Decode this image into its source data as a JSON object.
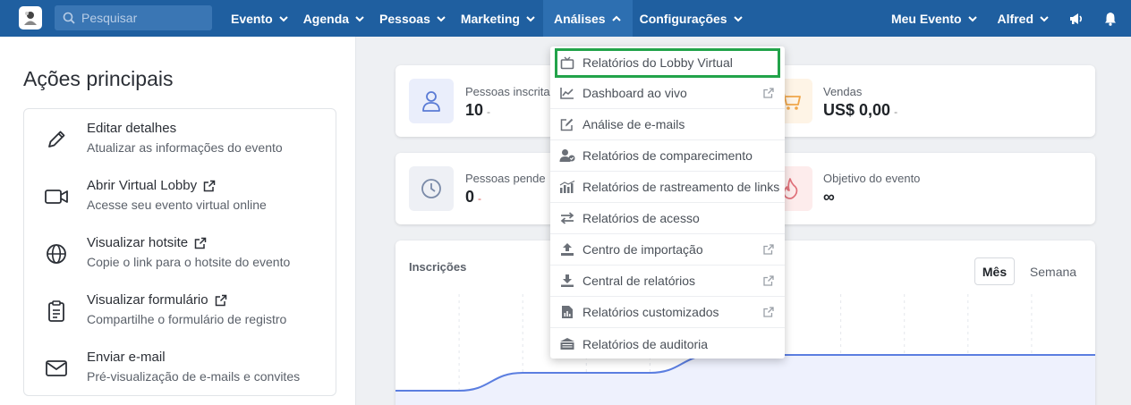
{
  "topbar": {
    "search_placeholder": "Pesquisar",
    "nav": [
      "Evento",
      "Agenda",
      "Pessoas",
      "Marketing",
      "Análises",
      "Configurações"
    ],
    "right": [
      "Meu Evento",
      "Alfred"
    ],
    "colors": {
      "bar": "#1f5fa0",
      "active": "#2d6fb1"
    }
  },
  "sidebar": {
    "title": "Ações principais",
    "actions": [
      {
        "title": "Editar detalhes",
        "subtitle": "Atualizar as informações do evento",
        "icon": "pencil-icon"
      },
      {
        "title": "Abrir Virtual Lobby",
        "subtitle": "Acesse seu evento virtual online",
        "icon": "video-camera-icon",
        "external": true
      },
      {
        "title": "Visualizar hotsite",
        "subtitle": "Copie o link para o hotsite do evento",
        "icon": "globe-icon",
        "external": true
      },
      {
        "title": "Visualizar formulário",
        "subtitle": "Compartilhe o formulário de registro",
        "icon": "clipboard-icon",
        "external": true
      },
      {
        "title": "Enviar e-mail",
        "subtitle": "Pré-visualização de e-mails e convites",
        "icon": "envelope-icon"
      }
    ]
  },
  "stats": {
    "inscritas_label": "Pessoas inscrita",
    "inscritas_value": "10",
    "vendas_label": "Vendas",
    "vendas_value": "US$ 0,00",
    "pendentes_label": "Pessoas pende",
    "pendentes_value": "0",
    "objetivo_label": "Objetivo do evento",
    "objetivo_value": "∞",
    "dash": "-"
  },
  "chart": {
    "title": "Inscrições",
    "tab_month": "Mês",
    "tab_week": "Semana"
  },
  "chart_data": {
    "type": "area",
    "title": "Inscrições",
    "series": [
      {
        "values": [
          0,
          0,
          2,
          2,
          2,
          4,
          4,
          4,
          4,
          4,
          4,
          4
        ]
      }
    ]
  },
  "dropdown": {
    "items": [
      {
        "label": "Relatórios do Lobby Virtual",
        "icon": "tv-icon",
        "external": false
      },
      {
        "label": "Dashboard ao vivo",
        "icon": "line-chart-icon",
        "external": true
      },
      {
        "label": "Análise de e-mails",
        "icon": "edit-square-icon",
        "external": false
      },
      {
        "label": "Relatórios de comparecimento",
        "icon": "user-check-icon",
        "external": false
      },
      {
        "label": "Relatórios de rastreamento de links",
        "icon": "bar-chart-icon",
        "external": false
      },
      {
        "label": "Relatórios de acesso",
        "icon": "exchange-icon",
        "external": false
      },
      {
        "label": "Centro de importação",
        "icon": "upload-icon",
        "external": true
      },
      {
        "label": "Central de relatórios",
        "icon": "download-icon",
        "external": true
      },
      {
        "label": "Relatórios customizados",
        "icon": "file-chart-icon",
        "external": true
      },
      {
        "label": "Relatórios de auditoria",
        "icon": "archive-icon",
        "external": false
      }
    ],
    "highlight_color": "#22a34a"
  }
}
